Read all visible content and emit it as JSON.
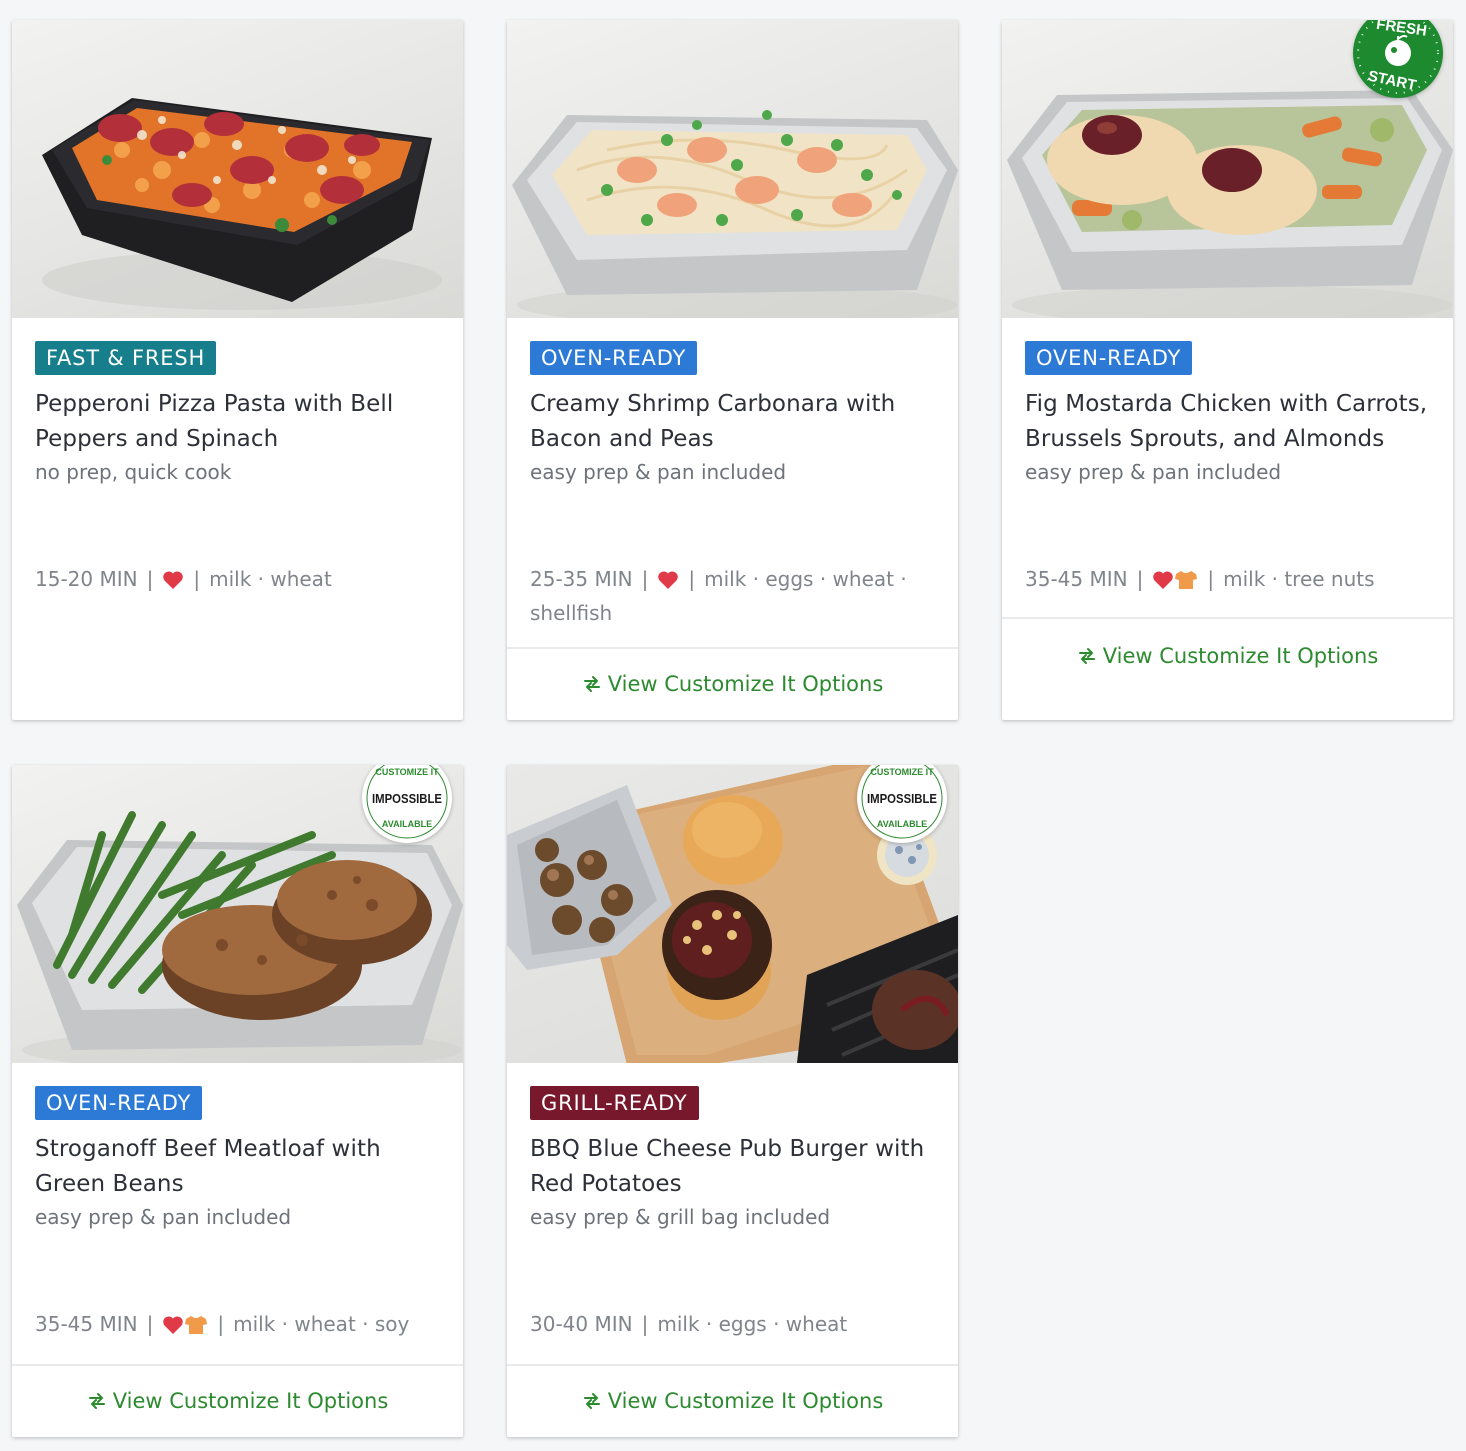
{
  "meals": [
    {
      "badge": "FAST & FRESH",
      "badge_color": "#167f8b",
      "title": "Pepperoni Pizza Pasta with Bell Peppers and Spinach",
      "subtitle": "no prep, quick cook",
      "time": "15-20 MIN",
      "icons": [
        "heart-icon"
      ],
      "allergens": "milk · wheat",
      "customize": null
    },
    {
      "badge": "OVEN-READY",
      "badge_color": "#2c7ad6",
      "title": "Creamy Shrimp Carbonara with Bacon and Peas",
      "subtitle": "easy prep & pan included",
      "time": "25-35 MIN",
      "icons": [
        "heart-icon"
      ],
      "allergens": "milk · eggs · wheat · shellfish",
      "customize": "View Customize It Options"
    },
    {
      "badge": "OVEN-READY",
      "badge_color": "#2c7ad6",
      "title": "Fig Mostarda Chicken with Carrots, Brussels Sprouts, and Almonds",
      "subtitle": "easy prep & pan included",
      "time": "35-45 MIN",
      "icons": [
        "heart-icon",
        "chef-shirt-icon"
      ],
      "allergens": "milk · tree nuts",
      "customize": "View Customize It Options",
      "seal": {
        "type": "fresh-start",
        "top_text": "FRESH",
        "bottom_text": "START",
        "color": "#1d8a2f"
      }
    },
    {
      "badge": "OVEN-READY",
      "badge_color": "#2c7ad6",
      "title": "Stroganoff Beef Meatloaf with Green Beans",
      "subtitle": "easy prep & pan included",
      "time": "35-45 MIN",
      "icons": [
        "heart-icon",
        "chef-shirt-icon"
      ],
      "allergens": "milk · wheat · soy",
      "customize": "View Customize It Options",
      "seal": {
        "type": "impossible",
        "top_text": "CUSTOMIZE IT",
        "middle_text": "IMPOSSIBLE",
        "bottom_text": "AVAILABLE"
      }
    },
    {
      "badge": "GRILL-READY",
      "badge_color": "#77182d",
      "title": "BBQ Blue Cheese Pub Burger with Red Potatoes",
      "subtitle": "easy prep & grill bag included",
      "time": "30-40 MIN",
      "icons": [],
      "allergens": "milk · eggs · wheat",
      "customize": "View Customize It Options",
      "seal": {
        "type": "impossible",
        "top_text": "CUSTOMIZE IT",
        "middle_text": "IMPOSSIBLE",
        "bottom_text": "AVAILABLE"
      }
    }
  ],
  "colors": {
    "link_green": "#2c8a2f",
    "heart_red": "#e03a48",
    "chef_orange": "#f09a4a",
    "muted_text": "#80848b"
  }
}
